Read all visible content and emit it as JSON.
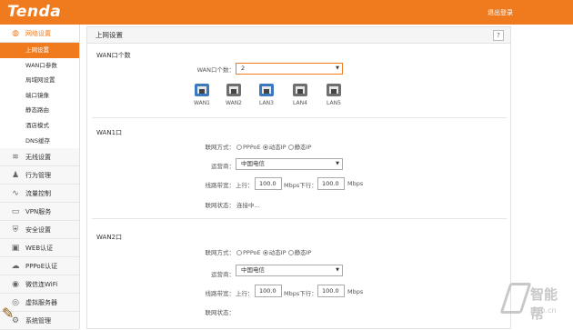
{
  "header": {
    "logo": "Tenda",
    "logout": "退出登录"
  },
  "sidebar": {
    "groups": [
      {
        "label": "网络设置",
        "icon": "globe-icon",
        "glyph": "◍",
        "active": true
      },
      {
        "label": "无线设置",
        "icon": "wifi-icon",
        "glyph": "≋"
      },
      {
        "label": "行为管理",
        "icon": "user-icon",
        "glyph": "♟"
      },
      {
        "label": "流量控制",
        "icon": "chart-icon",
        "glyph": "∿"
      },
      {
        "label": "VPN服务",
        "icon": "vpn-icon",
        "glyph": "▭"
      },
      {
        "label": "安全设置",
        "icon": "shield-icon",
        "glyph": "⛨"
      },
      {
        "label": "WEB认证",
        "icon": "lock-icon",
        "glyph": "▣"
      },
      {
        "label": "PPPoE认证",
        "icon": "cloud-icon",
        "glyph": "☁"
      },
      {
        "label": "微信连WiFi",
        "icon": "wechat-icon",
        "glyph": "◉"
      },
      {
        "label": "虚拟服务器",
        "icon": "server-icon",
        "glyph": "◎"
      },
      {
        "label": "系统管理",
        "icon": "gear-icon",
        "glyph": "⚙"
      }
    ],
    "subitems": [
      "上网设置",
      "WAN口参数",
      "局域网设置",
      "端口镜像",
      "静态路由",
      "酒店模式",
      "DNS缓存"
    ]
  },
  "main": {
    "title": "上网设置",
    "help": "?",
    "wan_count_section": "WAN口个数",
    "wan_count_label": "WAN口个数：",
    "wan_count_value": "2",
    "ports": [
      {
        "label": "WAN1",
        "color": "#3a78c0"
      },
      {
        "label": "WAN2",
        "color": "#6e6e6e"
      },
      {
        "label": "LAN3",
        "color": "#3a78c0"
      },
      {
        "label": "LAN4",
        "color": "#6e6e6e"
      },
      {
        "label": "LAN5",
        "color": "#6e6e6e"
      }
    ],
    "wan1": {
      "title": "WAN1口",
      "mode_label": "联网方式：",
      "modes": [
        "PPPoE",
        "动态IP",
        "静态IP"
      ],
      "mode_selected": "动态IP",
      "isp_label": "运营商：",
      "isp_value": "中国电信",
      "bw_label": "线路带宽：",
      "up_label": "上行：",
      "up_value": "100.0",
      "up_unit_down_label": "Mbps下行：",
      "down_value": "100.0",
      "down_unit": "Mbps",
      "status_label": "联网状态：",
      "status_value": "连接中..."
    },
    "wan2": {
      "title": "WAN2口",
      "mode_label": "联网方式：",
      "modes": [
        "PPPoE",
        "动态IP",
        "静态IP"
      ],
      "mode_selected": "动态IP",
      "isp_label": "运营商：",
      "isp_value": "中国电信",
      "bw_label": "线路带宽：",
      "up_label": "上行：",
      "up_value": "100.0",
      "up_unit_down_label": "Mbps下行：",
      "down_value": "100.0",
      "down_unit": "Mbps",
      "status_label": "联网状态：",
      "status_value": ""
    }
  },
  "watermark": {
    "text": "智能帮",
    "url": "iznb.cn"
  },
  "colors": {
    "brand": "#f07b1f",
    "port_active": "#3a78c0",
    "port_inactive": "#6e6e6e"
  }
}
